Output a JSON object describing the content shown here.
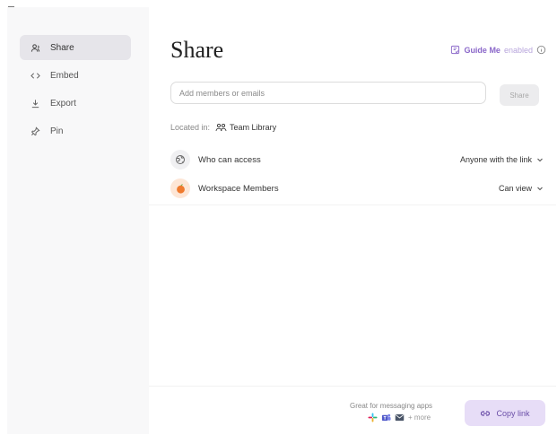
{
  "sidebar": {
    "items": [
      {
        "label": "Share",
        "icon": "users-icon",
        "active": true
      },
      {
        "label": "Embed",
        "icon": "code-icon"
      },
      {
        "label": "Export",
        "icon": "download-icon"
      },
      {
        "label": "Pin",
        "icon": "pin-icon"
      }
    ]
  },
  "main": {
    "title": "Share",
    "guide": {
      "label": "Guide Me",
      "state": "enabled"
    },
    "invite": {
      "placeholder": "Add members or emails",
      "value": ""
    },
    "share_button": "Share",
    "located": {
      "label": "Located in:",
      "library": "Team Library"
    },
    "access_rows": [
      {
        "label": "Who can access",
        "value": "Anyone with the link"
      },
      {
        "label": "Workspace Members",
        "value": "Can view"
      }
    ]
  },
  "footer": {
    "messaging_caption": "Great for messaging apps",
    "more_label": "+ more",
    "copy_link": "Copy link"
  },
  "colors": {
    "accent": "#8a67c9",
    "copy_button_bg": "#e7ddf7",
    "sidebar_bg": "#f8f8f9",
    "active_item_bg": "#e6e5ea"
  }
}
